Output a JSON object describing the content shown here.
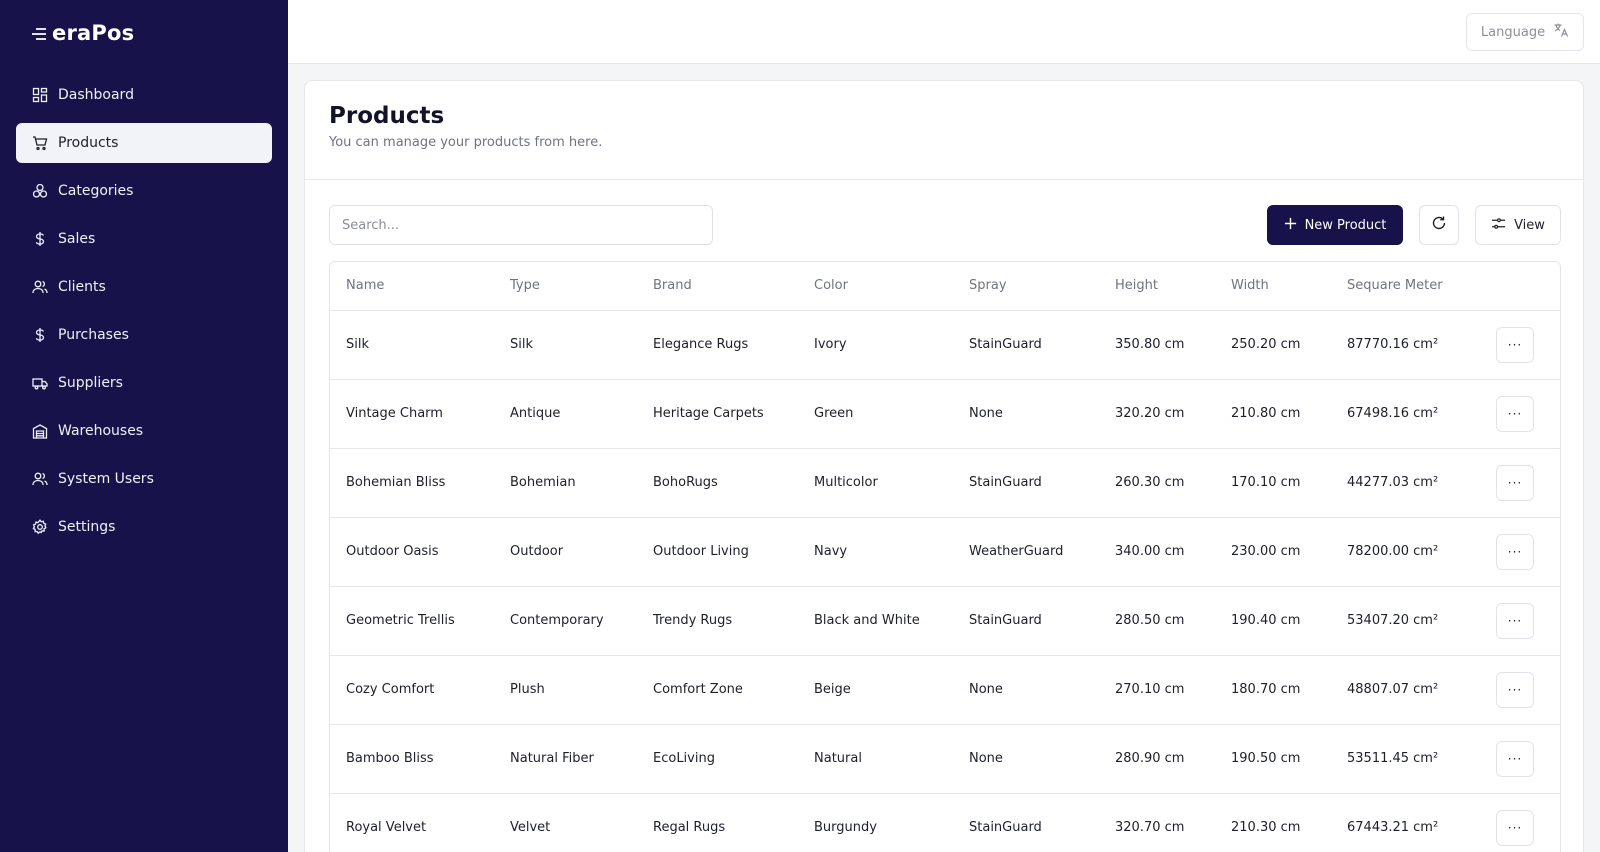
{
  "brand": {
    "name": "eraPos"
  },
  "sidebar": {
    "items": [
      {
        "label": "Dashboard",
        "icon": "dashboard-icon",
        "active": false
      },
      {
        "label": "Products",
        "icon": "cart-icon",
        "active": true
      },
      {
        "label": "Categories",
        "icon": "categories-icon",
        "active": false
      },
      {
        "label": "Sales",
        "icon": "dollar-icon",
        "active": false
      },
      {
        "label": "Clients",
        "icon": "users-icon",
        "active": false
      },
      {
        "label": "Purchases",
        "icon": "dollar-icon",
        "active": false
      },
      {
        "label": "Suppliers",
        "icon": "truck-icon",
        "active": false
      },
      {
        "label": "Warehouses",
        "icon": "warehouse-icon",
        "active": false
      },
      {
        "label": "System Users",
        "icon": "users-icon",
        "active": false
      },
      {
        "label": "Settings",
        "icon": "gear-icon",
        "active": false
      }
    ]
  },
  "topbar": {
    "language_label": "Language"
  },
  "page": {
    "title": "Products",
    "subtitle": "You can manage your products from here."
  },
  "toolbar": {
    "search_placeholder": "Search...",
    "new_product_label": "New Product",
    "view_label": "View"
  },
  "table": {
    "headers": [
      "Name",
      "Type",
      "Brand",
      "Color",
      "Spray",
      "Height",
      "Width",
      "Sequare Meter"
    ],
    "rows": [
      [
        "Silk",
        "Silk",
        "Elegance Rugs",
        "Ivory",
        "StainGuard",
        "350.80 cm",
        "250.20 cm",
        "87770.16 cm²"
      ],
      [
        "Vintage Charm",
        "Antique",
        "Heritage Carpets",
        "Green",
        "None",
        "320.20 cm",
        "210.80 cm",
        "67498.16 cm²"
      ],
      [
        "Bohemian Bliss",
        "Bohemian",
        "BohoRugs",
        "Multicolor",
        "StainGuard",
        "260.30 cm",
        "170.10 cm",
        "44277.03 cm²"
      ],
      [
        "Outdoor Oasis",
        "Outdoor",
        "Outdoor Living",
        "Navy",
        "WeatherGuard",
        "340.00 cm",
        "230.00 cm",
        "78200.00 cm²"
      ],
      [
        "Geometric Trellis",
        "Contemporary",
        "Trendy Rugs",
        "Black and White",
        "StainGuard",
        "280.50 cm",
        "190.40 cm",
        "53407.20 cm²"
      ],
      [
        "Cozy Comfort",
        "Plush",
        "Comfort Zone",
        "Beige",
        "None",
        "270.10 cm",
        "180.70 cm",
        "48807.07 cm²"
      ],
      [
        "Bamboo Bliss",
        "Natural Fiber",
        "EcoLiving",
        "Natural",
        "None",
        "280.90 cm",
        "190.50 cm",
        "53511.45 cm²"
      ],
      [
        "Royal Velvet",
        "Velvet",
        "Regal Rugs",
        "Burgundy",
        "StainGuard",
        "320.70 cm",
        "210.30 cm",
        "67443.21 cm²"
      ]
    ],
    "row_action_label": "···"
  },
  "colors": {
    "sidebar_bg": "#17134a",
    "primary": "#17134a",
    "active_item_bg": "#f1f3f8"
  }
}
